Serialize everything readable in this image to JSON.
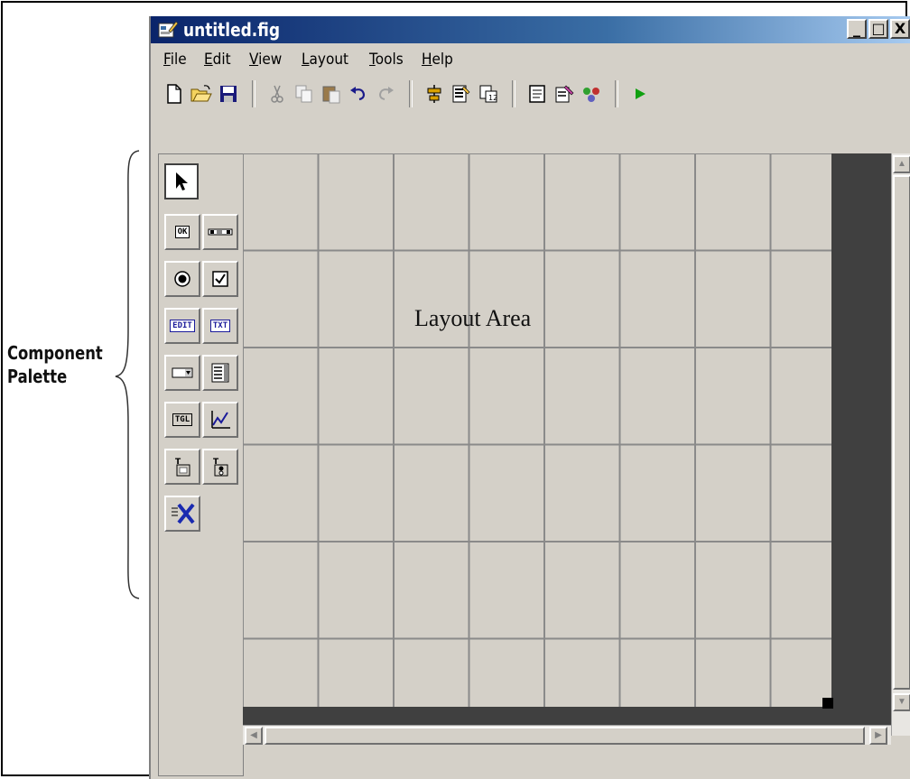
{
  "annotation": {
    "line1": "Component",
    "line2": "Palette"
  },
  "window": {
    "title": "untitled.fig",
    "controls": {
      "minimize": "_",
      "maximize": "□",
      "close": "X"
    }
  },
  "menu": [
    {
      "underline": "F",
      "rest": "ile"
    },
    {
      "underline": "E",
      "rest": "dit"
    },
    {
      "underline": "V",
      "rest": "iew"
    },
    {
      "underline": "L",
      "rest": "ayout"
    },
    {
      "underline": "T",
      "rest": "ools"
    },
    {
      "underline": "H",
      "rest": "elp"
    }
  ],
  "toolbar": {
    "icons": [
      "new-icon",
      "open-folder-icon",
      "save-icon",
      "cut-icon",
      "copy-icon",
      "paste-icon",
      "undo-icon",
      "redo-icon",
      "align-icon",
      "menu-editor-icon",
      "tab-order-icon",
      "m-file-editor-icon",
      "property-inspector-icon",
      "object-browser-icon",
      "run-icon"
    ]
  },
  "palette": {
    "badges": {
      "ok": "OK",
      "edit": "EDIT",
      "txt": "TXT",
      "tgl": "TGL"
    }
  },
  "layout_area": {
    "label": "Layout Area"
  }
}
